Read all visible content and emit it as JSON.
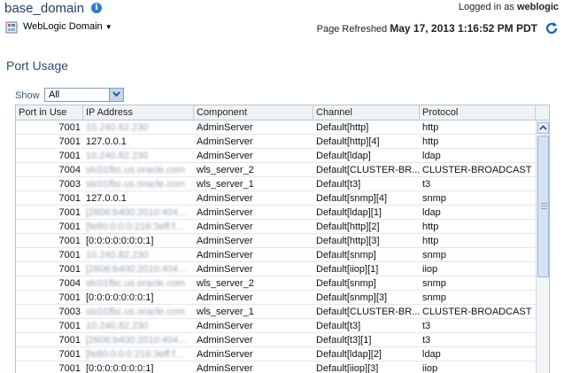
{
  "header": {
    "domain_title": "base_domain",
    "login_prefix": "Logged in as",
    "login_user": "weblogic",
    "menu_label": "WebLogic Domain",
    "refresh_prefix": "Page Refreshed",
    "refresh_time": "May 17, 2013 1:16:52 PM PDT"
  },
  "page": {
    "section_title": "Port Usage",
    "show_label": "Show",
    "show_value": "All"
  },
  "table": {
    "columns": [
      "Port in Use",
      "IP Address",
      "Component",
      "Channel",
      "Protocol"
    ],
    "rows": [
      {
        "port": "7001",
        "ip": "10.240.82.230",
        "ip_blurred": true,
        "component": "AdminServer",
        "channel": "Default[http]",
        "protocol": "http"
      },
      {
        "port": "7001",
        "ip": "127.0.0.1",
        "ip_blurred": false,
        "component": "AdminServer",
        "channel": "Default[http][4]",
        "protocol": "http"
      },
      {
        "port": "7001",
        "ip": "10.240.82.230",
        "ip_blurred": true,
        "component": "AdminServer",
        "channel": "Default[ldap]",
        "protocol": "ldap"
      },
      {
        "port": "7004",
        "ip": "slc01fbc.us.oracle.com",
        "ip_blurred": true,
        "component": "wls_server_2",
        "channel": "Default[CLUSTER-BR...",
        "protocol": "CLUSTER-BROADCAST"
      },
      {
        "port": "7003",
        "ip": "slc01fbc.us.oracle.com",
        "ip_blurred": true,
        "component": "wls_server_1",
        "channel": "Default[t3]",
        "protocol": "t3"
      },
      {
        "port": "7001",
        "ip": "127.0.0.1",
        "ip_blurred": false,
        "component": "AdminServer",
        "channel": "Default[snmp][4]",
        "protocol": "snmp"
      },
      {
        "port": "7001",
        "ip": "[2606:b400:2010:404...",
        "ip_blurred": true,
        "component": "AdminServer",
        "channel": "Default[ldap][1]",
        "protocol": "ldap"
      },
      {
        "port": "7001",
        "ip": "[fe80:0:0:0:216:3eff:f...",
        "ip_blurred": true,
        "component": "AdminServer",
        "channel": "Default[http][2]",
        "protocol": "http"
      },
      {
        "port": "7001",
        "ip": "[0:0:0:0:0:0:0:1]",
        "ip_blurred": false,
        "component": "AdminServer",
        "channel": "Default[http][3]",
        "protocol": "http"
      },
      {
        "port": "7001",
        "ip": "10.240.82.230",
        "ip_blurred": true,
        "component": "AdminServer",
        "channel": "Default[snmp]",
        "protocol": "snmp"
      },
      {
        "port": "7001",
        "ip": "[2606:b400:2010:404...",
        "ip_blurred": true,
        "component": "AdminServer",
        "channel": "Default[iiop][1]",
        "protocol": "iiop"
      },
      {
        "port": "7004",
        "ip": "slc01fbc.us.oracle.com",
        "ip_blurred": true,
        "component": "wls_server_2",
        "channel": "Default[snmp]",
        "protocol": "snmp"
      },
      {
        "port": "7001",
        "ip": "[0:0:0:0:0:0:0:1]",
        "ip_blurred": false,
        "component": "AdminServer",
        "channel": "Default[snmp][3]",
        "protocol": "snmp"
      },
      {
        "port": "7003",
        "ip": "slc01fbc.us.oracle.com",
        "ip_blurred": true,
        "component": "wls_server_1",
        "channel": "Default[CLUSTER-BR...",
        "protocol": "CLUSTER-BROADCAST"
      },
      {
        "port": "7001",
        "ip": "10.240.82.230",
        "ip_blurred": true,
        "component": "AdminServer",
        "channel": "Default[t3]",
        "protocol": "t3"
      },
      {
        "port": "7001",
        "ip": "[2606:b400:2010:404...",
        "ip_blurred": true,
        "component": "AdminServer",
        "channel": "Default[t3][1]",
        "protocol": "t3"
      },
      {
        "port": "7001",
        "ip": "[fe80:0:0:0:216:3eff:f...",
        "ip_blurred": true,
        "component": "AdminServer",
        "channel": "Default[ldap][2]",
        "protocol": "ldap"
      },
      {
        "port": "7001",
        "ip": "[0:0:0:0:0:0:0:1]",
        "ip_blurred": false,
        "component": "AdminServer",
        "channel": "Default[iiop][3]",
        "protocol": "iiop"
      }
    ]
  },
  "icons": {
    "info": "info-icon",
    "domain_menu": "weblogic-domain-icon",
    "refresh": "refresh-icon",
    "dropdown": "chevron-down-icon",
    "scroll_up": "scroll-up-arrow-icon"
  },
  "colors": {
    "title": "#1f3f63",
    "section": "#2b4c6f",
    "accent": "#2d7bd1"
  }
}
